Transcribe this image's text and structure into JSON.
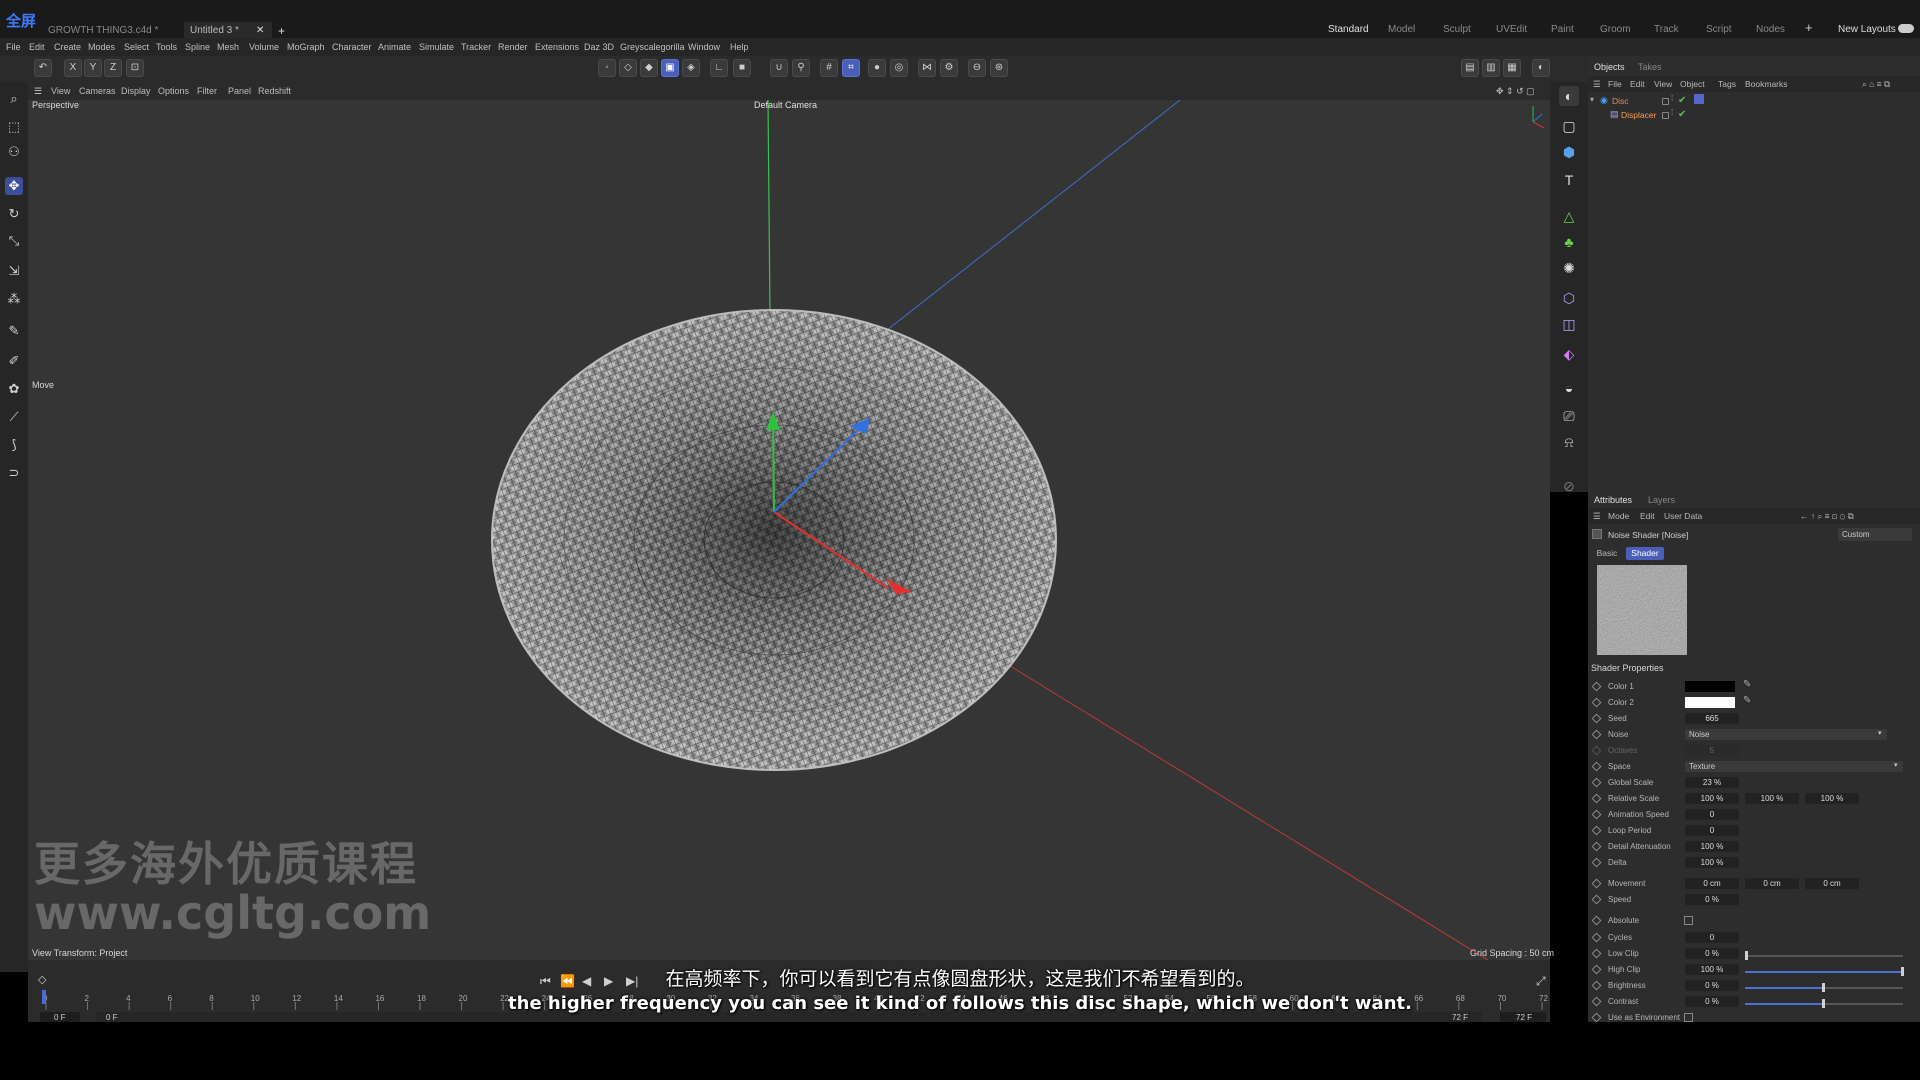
{
  "app_badge": "全屏",
  "document_tabs": [
    "GROWTH THING3.c4d *",
    "Untitled 3 *"
  ],
  "layout_tabs": [
    "Standard",
    "Model",
    "Sculpt",
    "UVEdit",
    "Paint",
    "Groom",
    "Track",
    "Script",
    "Nodes"
  ],
  "layout_active": "Standard",
  "new_layouts": "New Layouts",
  "menu": [
    "File",
    "Edit",
    "Create",
    "Modes",
    "Select",
    "Tools",
    "Spline",
    "Mesh",
    "Volume",
    "MoGraph",
    "Character",
    "Animate",
    "Simulate",
    "Tracker",
    "Render",
    "Extensions",
    "Daz 3D",
    "Greyscalegorilla",
    "Window",
    "Help"
  ],
  "toolbar_axes": [
    "X",
    "Y",
    "Z"
  ],
  "viewport": {
    "menu": [
      "View",
      "Cameras",
      "Display",
      "Options",
      "Filter",
      "Panel",
      "Redshift"
    ],
    "projection": "Perspective",
    "camera": "Default Camera",
    "tool_label": "Move",
    "view_transform": "View Transform: Project",
    "grid_spacing": "Grid Spacing : 50 cm"
  },
  "watermark": {
    "line1": "更多海外优质课程",
    "line2": "www.cgltg.com"
  },
  "objects_panel": {
    "tabs": [
      "Objects",
      "Takes"
    ],
    "menu": [
      "File",
      "Edit",
      "View",
      "Object",
      "Tags",
      "Bookmarks"
    ],
    "items": [
      {
        "name": "Disc",
        "color": "#e88a5a"
      },
      {
        "name": "Displacer",
        "color": "#ff9a50"
      }
    ]
  },
  "attributes_panel": {
    "tabs": [
      "Attributes",
      "Layers"
    ],
    "menu": [
      "Mode",
      "Edit",
      "User Data"
    ],
    "title": "Noise Shader [Noise]",
    "preset": "Custom",
    "subtabs": [
      "Basic",
      "Shader"
    ],
    "section": "Shader Properties",
    "properties": {
      "color1": {
        "label": "Color 1",
        "value": "#000000"
      },
      "color2": {
        "label": "Color 2",
        "value": "#ffffff"
      },
      "seed": {
        "label": "Seed",
        "value": "665"
      },
      "noise": {
        "label": "Noise",
        "value": "Noise"
      },
      "octaves": {
        "label": "Octaves",
        "value": "5"
      },
      "space": {
        "label": "Space",
        "value": "Texture"
      },
      "global_scale": {
        "label": "Global Scale",
        "value": "23 %"
      },
      "relative_scale": {
        "label": "Relative Scale",
        "values": [
          "100 %",
          "100 %",
          "100 %"
        ]
      },
      "animation_speed": {
        "label": "Animation Speed",
        "value": "0"
      },
      "loop_period": {
        "label": "Loop Period",
        "value": "0"
      },
      "detail_attenuation": {
        "label": "Detail Attenuation",
        "value": "100 %"
      },
      "delta": {
        "label": "Delta",
        "value": "100 %"
      },
      "movement": {
        "label": "Movement",
        "values": [
          "0 cm",
          "0 cm",
          "0 cm"
        ]
      },
      "speed": {
        "label": "Speed",
        "value": "0 %"
      },
      "absolute": {
        "label": "Absolute",
        "checked": false
      },
      "cycles": {
        "label": "Cycles",
        "value": "0"
      },
      "low_clip": {
        "label": "Low Clip",
        "value": "0 %",
        "fraction": 0.0
      },
      "high_clip": {
        "label": "High Clip",
        "value": "100 %",
        "fraction": 1.0
      },
      "brightness": {
        "label": "Brightness",
        "value": "0 %",
        "fraction": 0.5
      },
      "contrast": {
        "label": "Contrast",
        "value": "0 %",
        "fraction": 0.5
      },
      "use_as_environment": {
        "label": "Use as Environment",
        "checked": false
      }
    }
  },
  "timeline": {
    "ticks": [
      "0",
      "2",
      "4",
      "6",
      "8",
      "10",
      "12",
      "14",
      "16",
      "18",
      "20",
      "22",
      "24",
      "26",
      "28",
      "30",
      "32",
      "34",
      "36",
      "38",
      "40",
      "42",
      "44",
      "46",
      "48",
      "50",
      "52",
      "54",
      "56",
      "58",
      "60",
      "62",
      "64",
      "66",
      "68",
      "70",
      "72"
    ],
    "current": "0 F",
    "start": "0 F",
    "end": "72 F",
    "end2": "72 F"
  },
  "subtitles": {
    "cn": "在高频率下，你可以看到它有点像圆盘形状，这是我们不希望看到的。",
    "en": "the higher frequency you can see it kind of follows this disc shape, which we don't want."
  },
  "colors": {
    "accent": "#4b5fb8",
    "axis_x": "#e03030",
    "axis_y": "#30c040",
    "axis_z": "#3070e0"
  }
}
